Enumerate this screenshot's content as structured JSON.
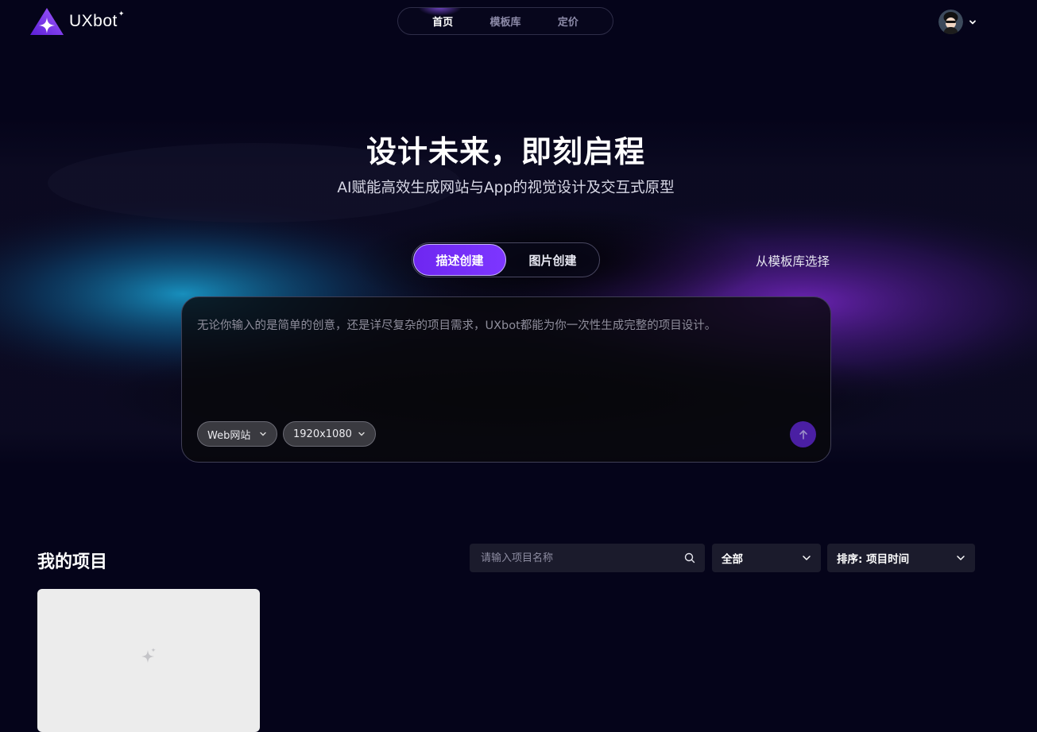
{
  "brand": {
    "name": "UXbot",
    "star": "✦",
    "logo_icon": "uxbot-triangle-logo"
  },
  "nav": {
    "items": [
      {
        "label": "首页",
        "active": true
      },
      {
        "label": "模板库",
        "active": false
      },
      {
        "label": "定价",
        "active": false
      }
    ]
  },
  "account": {
    "avatar_icon": "user-avatar",
    "caret_icon": "chevron-down-icon"
  },
  "hero": {
    "title": "设计未来，即刻启程",
    "subtitle": "AI赋能高效生成网站与App的视觉设计及交互式原型"
  },
  "creation": {
    "tabs": [
      {
        "label": "描述创建",
        "active": true
      },
      {
        "label": "图片创建",
        "active": false
      }
    ],
    "template_link": "从模板库选择",
    "placeholder": "无论你输入的是简单的创意，还是详尽复杂的项目需求，UXbot都能为你一次性生成完整的项目设计。",
    "platform_select": "Web网站",
    "resolution_select": "1920x1080",
    "send_icon": "arrow-up-icon"
  },
  "projects": {
    "title": "我的项目",
    "search_placeholder": "请输入项目名称",
    "filter_value": "全部",
    "sort_value": "排序: 项目时间",
    "card_icon": "sparkle-icon"
  },
  "colors": {
    "background": "#05041a",
    "accent": "#7a30ff",
    "send_button": "#4a1fa3",
    "panel": "#1b1b2c"
  }
}
